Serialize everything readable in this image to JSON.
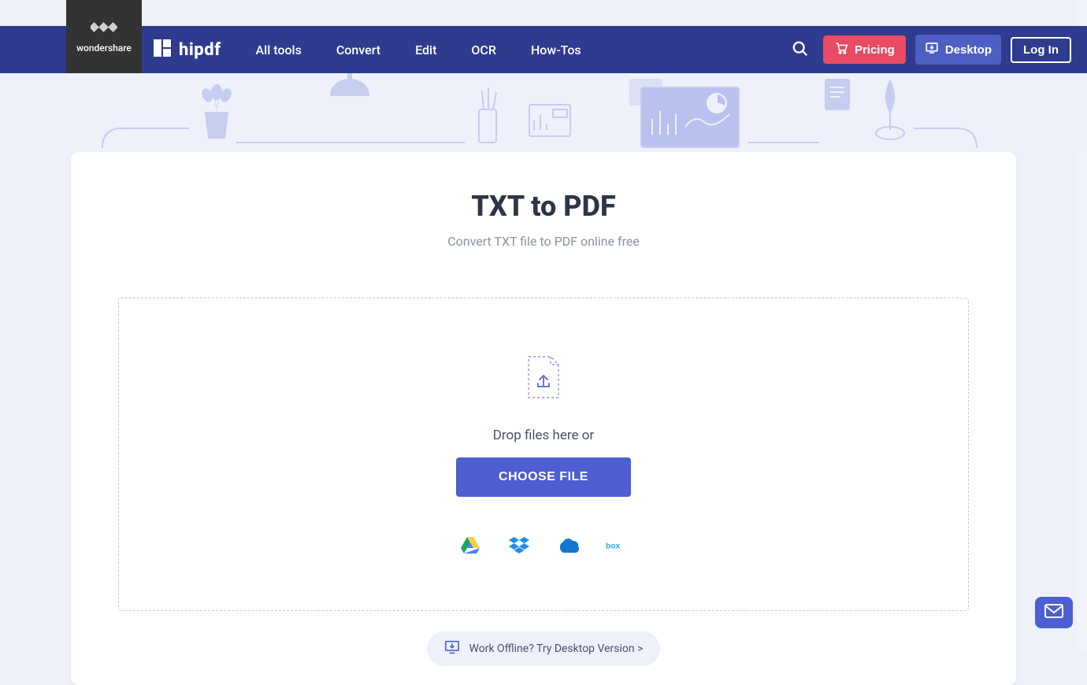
{
  "brand": {
    "wondershare_label": "wondershare",
    "hipdf_name": "hipdf"
  },
  "nav": {
    "all_tools": "All tools",
    "convert": "Convert",
    "edit": "Edit",
    "ocr": "OCR",
    "howtos": "How-Tos"
  },
  "header_buttons": {
    "pricing": "Pricing",
    "desktop": "Desktop",
    "login": "Log In"
  },
  "page": {
    "title": "TXT to PDF",
    "subtitle": "Convert TXT file to PDF online free"
  },
  "dropzone": {
    "drop_text": "Drop files here or",
    "choose_file": "CHOOSE FILE"
  },
  "cloud_providers": {
    "gdrive": "google-drive",
    "dropbox": "dropbox",
    "onedrive": "onedrive",
    "box": "box"
  },
  "offline": {
    "label": "Work Offline? Try Desktop Version >"
  },
  "colors": {
    "header_bg": "#2f3b8f",
    "accent_pink": "#e94a64",
    "accent_blue": "#4e5fd1",
    "page_bg": "#eef0fa"
  }
}
